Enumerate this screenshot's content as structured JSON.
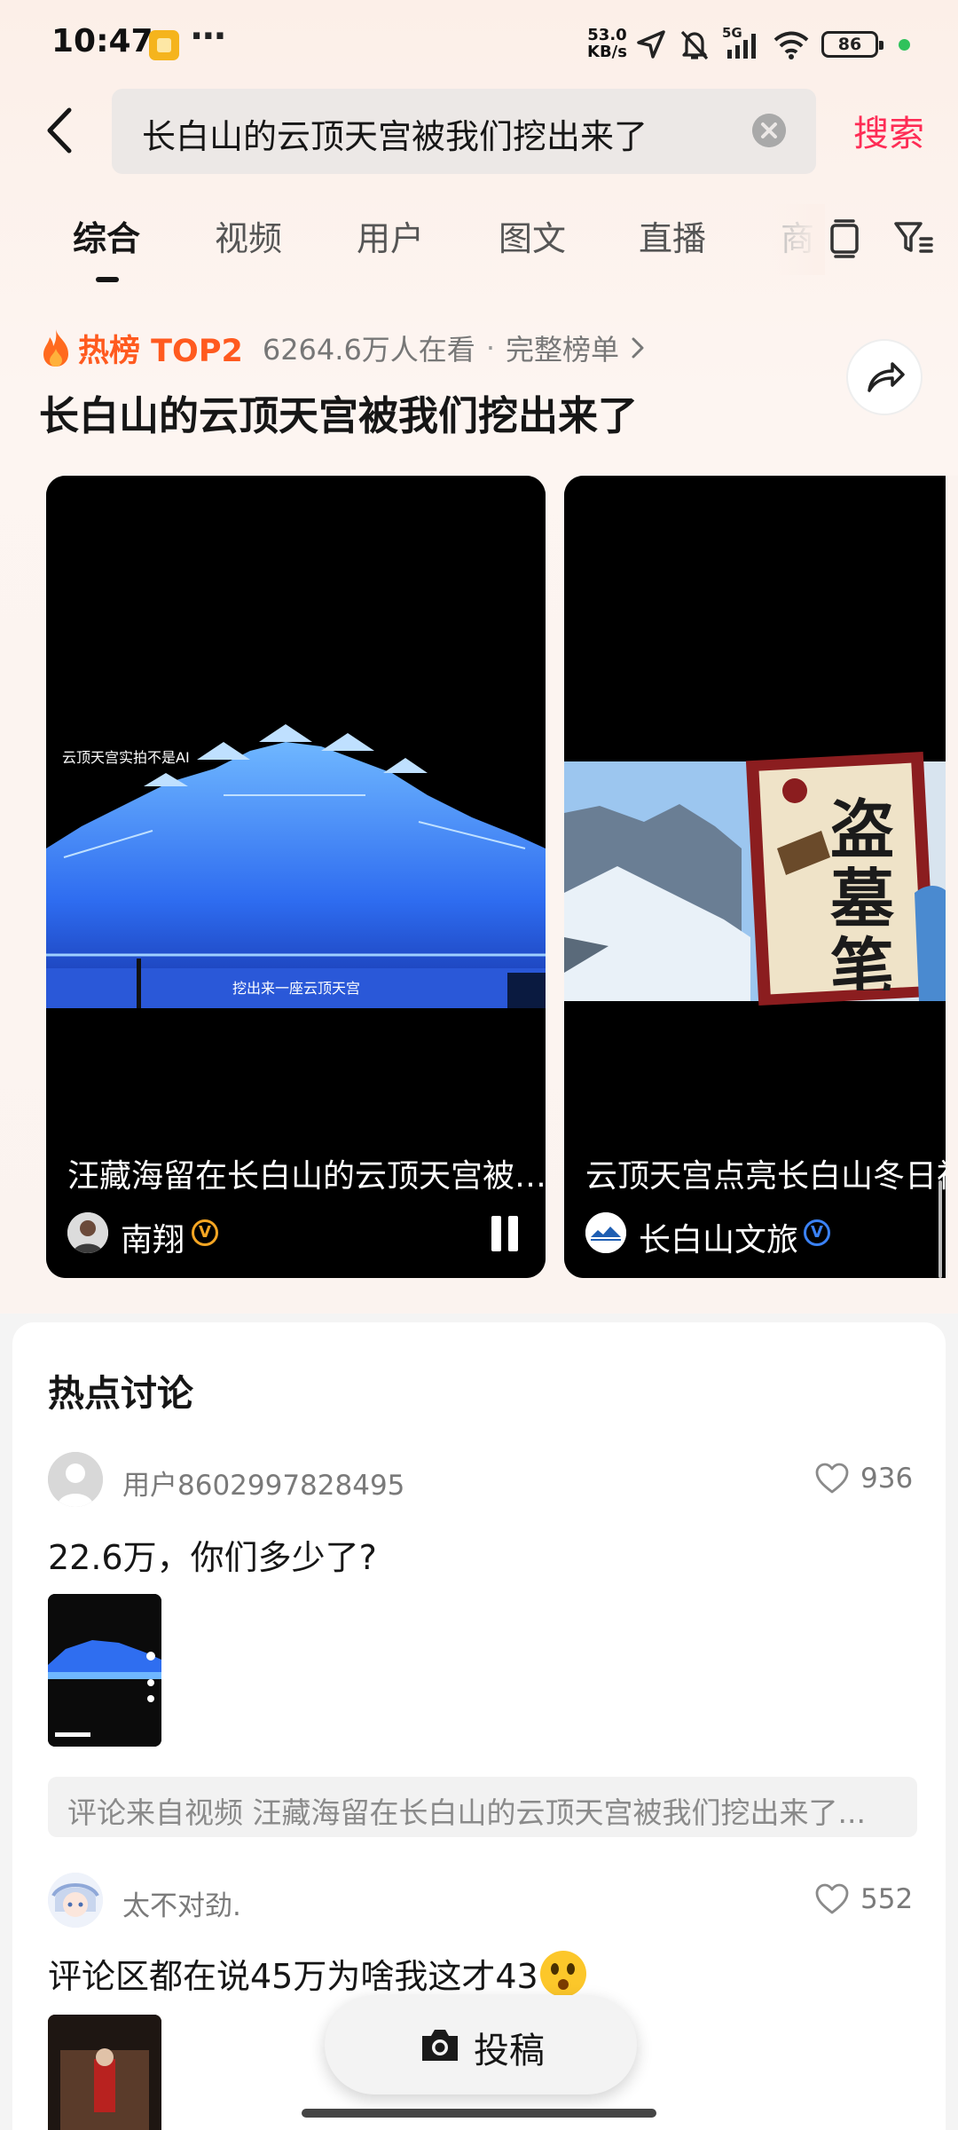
{
  "status_bar": {
    "time": "10:47",
    "net_speed_value": "53.0",
    "net_speed_unit": "KB/s",
    "network": "5G",
    "battery": "86"
  },
  "search": {
    "query": "长白山的云顶天宫被我们挖出来了",
    "search_label": "搜索"
  },
  "tabs": [
    {
      "label": "综合",
      "active": true
    },
    {
      "label": "视频"
    },
    {
      "label": "用户"
    },
    {
      "label": "图文"
    },
    {
      "label": "直播"
    },
    {
      "label": "商"
    }
  ],
  "hot_list": {
    "label": "热榜 TOP2",
    "views": "6264.6万人在看",
    "separator": "·",
    "full_list": "完整榜单",
    "title": "长白山的云顶天宫被我们挖出来了"
  },
  "videos": [
    {
      "title": "汪藏海留在长白山的云顶天宫被…",
      "author": "南翔",
      "verified": "V",
      "overlay_text": "云顶天宫实拍不是AI",
      "caption": "挖出来一座云顶天宫"
    },
    {
      "title": "云顶天宫点亮长白山冬日神",
      "author": "长白山文旅",
      "verified": "V",
      "book_text": "盗墓笔记"
    }
  ],
  "discussion": {
    "title": "热点讨论",
    "comments": [
      {
        "user": "用户8602997828495",
        "likes": "936",
        "text": "22.6万，你们多少了?",
        "from_video": "评论来自视频 汪藏海留在长白山的云顶天宫被我们挖出来了..."
      },
      {
        "user": "太不对劲.",
        "likes": "552",
        "text": "评论区都在说45万为啥我这才43"
      }
    ]
  },
  "post_button": {
    "label": "投稿"
  },
  "colors": {
    "accent": "#fe2c55",
    "hot": "#ff5a1f",
    "verified_gold": "#f6a623",
    "verified_blue": "#3b82f6"
  }
}
